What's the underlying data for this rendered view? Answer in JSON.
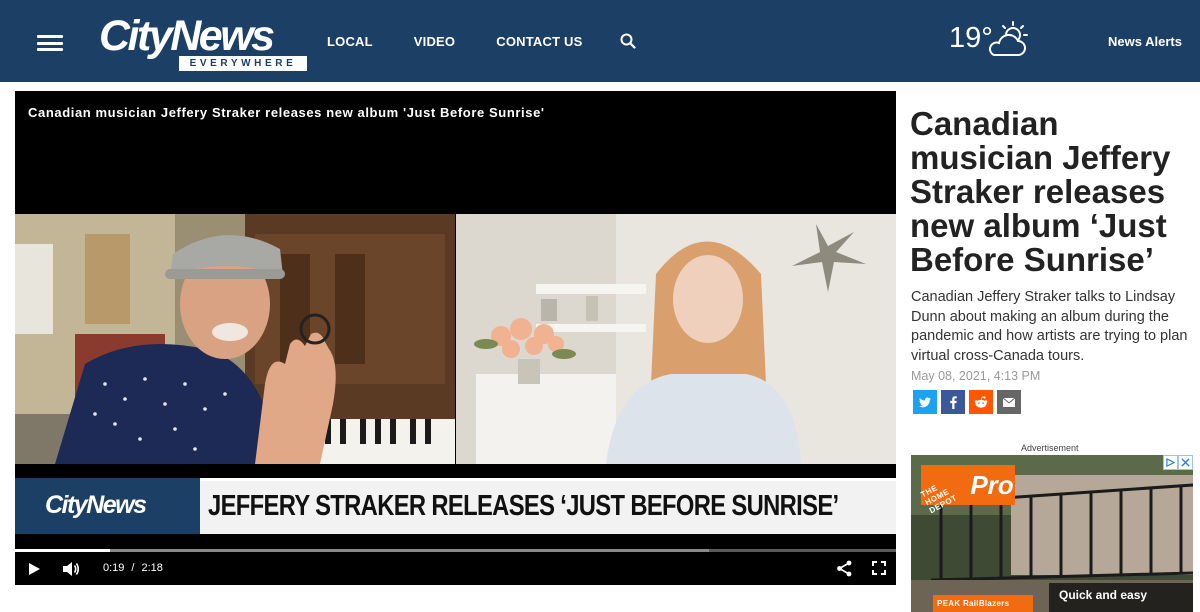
{
  "header": {
    "logo_word": "CityNews",
    "logo_tag": "EVERYWHERE",
    "nav": [
      "LOCAL",
      "VIDEO",
      "CONTACT US"
    ],
    "temperature": "19°",
    "alerts_label": "News Alerts"
  },
  "player": {
    "title": "Canadian musician Jeffery Straker releases new album 'Just Before Sunrise'",
    "lower_third_logo": "CityNews",
    "lower_third_text": "JEFFERY STRAKER RELEASES ‘JUST BEFORE SUNRISE’",
    "current_time": "0:19",
    "time_separator": "/",
    "duration": "2:18",
    "played_fraction": 0.108,
    "buffered_fraction": 0.788
  },
  "article": {
    "headline": "Canadian musician Jeffery Straker releases new album ‘Just Before Sunrise’",
    "summary": "Canadian Jeffery Straker talks to Lindsay Dunn about making an album during the pandemic and how artists are trying to plan virtual cross-Canada tours.",
    "date": "May 08, 2021, 4:13 PM"
  },
  "share": [
    {
      "icon": "twitter-icon",
      "color": "#1da1f2"
    },
    {
      "icon": "facebook-icon",
      "color": "#3b5998"
    },
    {
      "icon": "reddit-icon",
      "color": "#ff5700"
    },
    {
      "icon": "email-icon",
      "color": "#666666"
    }
  ],
  "ad": {
    "label": "Advertisement",
    "brand_text": "THE HOME DEPOT",
    "pro_text": "Pro",
    "cta": "Quick and easy",
    "bottom_badge": "PEAK RailBlazers"
  },
  "colors": {
    "header_bg": "#1c3f66",
    "brand_orange": "#f26b11"
  }
}
